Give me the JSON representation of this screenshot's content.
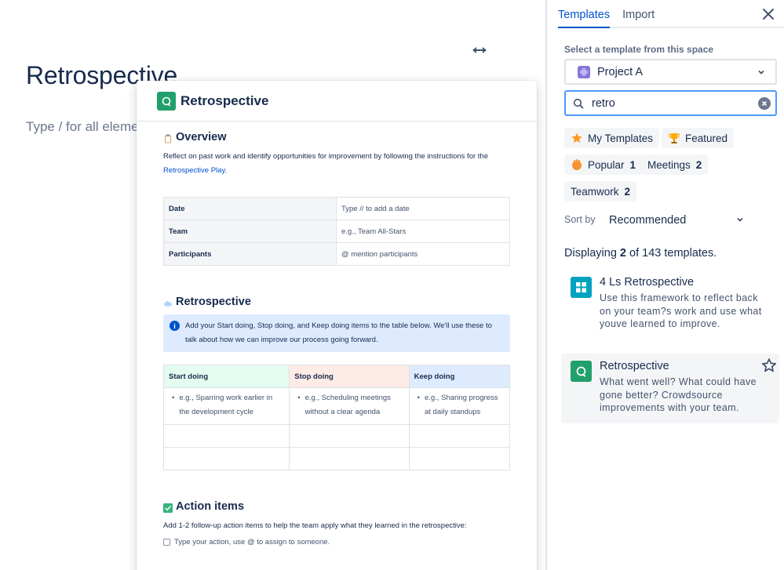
{
  "editor": {
    "title": "Retrospective",
    "placeholder": "Type / for all elements"
  },
  "preview": {
    "title": "Retrospective",
    "overview": {
      "heading": "Overview",
      "text_before_link": "Reflect on past work and identify opportunities for improvement by following the instructions for the ",
      "link_text": "Retrospective Play",
      "text_after_link": "."
    },
    "info_table": [
      {
        "label": "Date",
        "value": "Type // to add a date"
      },
      {
        "label": "Team",
        "value": "e.g., Team All-Stars"
      },
      {
        "label": "Participants",
        "value": "@ mention participants"
      }
    ],
    "retro_section": {
      "heading": "Retrospective",
      "info": "Add your Start doing, Stop doing, and Keep doing items to the table below. We'll use these to talk about how we can improve our process going forward.",
      "columns": [
        "Start doing",
        "Stop doing",
        "Keep doing"
      ],
      "examples": [
        "e.g., Sparring work earlier in the development cycle",
        "e.g., Scheduling meetings without a clear agenda",
        "e.g., Sharing progress at daily standups"
      ]
    },
    "action_items": {
      "heading": "Action items",
      "text": "Add 1-2 follow-up action items to help the team apply what they learned in the retrospective:",
      "task_placeholder": "Type your action, use @ to assign to someone."
    }
  },
  "panel": {
    "tabs": [
      "Templates",
      "Import"
    ],
    "select_label": "Select a template from this space",
    "space": "Project A",
    "search_value": "retro",
    "filters": [
      {
        "label": "My Templates",
        "count": ""
      },
      {
        "label": "Featured",
        "count": ""
      },
      {
        "label": "Popular",
        "count": "1"
      },
      {
        "label": "Meetings",
        "count": "2"
      },
      {
        "label": "Teamwork",
        "count": "2"
      }
    ],
    "sort_label": "Sort by",
    "sort_value": "Recommended",
    "displaying": {
      "prefix": "Displaying ",
      "shown": "2",
      "suffix": " of 143 templates."
    },
    "results": [
      {
        "title": "4 Ls Retrospective",
        "description": "Use this framework to reflect back on your team?s work and use what youve learned to improve.",
        "icon": "grid-icon",
        "color": "#00a3bf"
      },
      {
        "title": "Retrospective",
        "description": "What went well? What could have gone better? Crowdsource improvements with your team.",
        "icon": "retro-icon",
        "color": "#22a06b"
      }
    ]
  }
}
